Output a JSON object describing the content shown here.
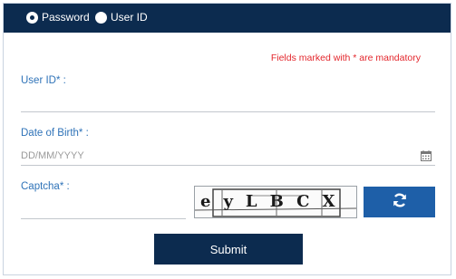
{
  "header": {
    "radio_password": "Password",
    "radio_userid": "User ID",
    "selected": "Password"
  },
  "form": {
    "mandatory_note": "Fields marked with * are mandatory",
    "userid_label": "User ID* :",
    "dob_label": "Date of Birth* :",
    "dob_placeholder": "DD/MM/YYYY",
    "captcha_label": "Captcha* :",
    "captcha_text": "eyLBCX",
    "submit_label": "Submit"
  },
  "colors": {
    "header_bg": "#0c2b4f",
    "label": "#2f73b8",
    "mandatory": "#e3262c",
    "refresh_bg": "#1e5fa8",
    "submit_bg": "#0c2b4f"
  },
  "icons": {
    "calendar": "calendar-icon",
    "refresh": "refresh-icon"
  }
}
